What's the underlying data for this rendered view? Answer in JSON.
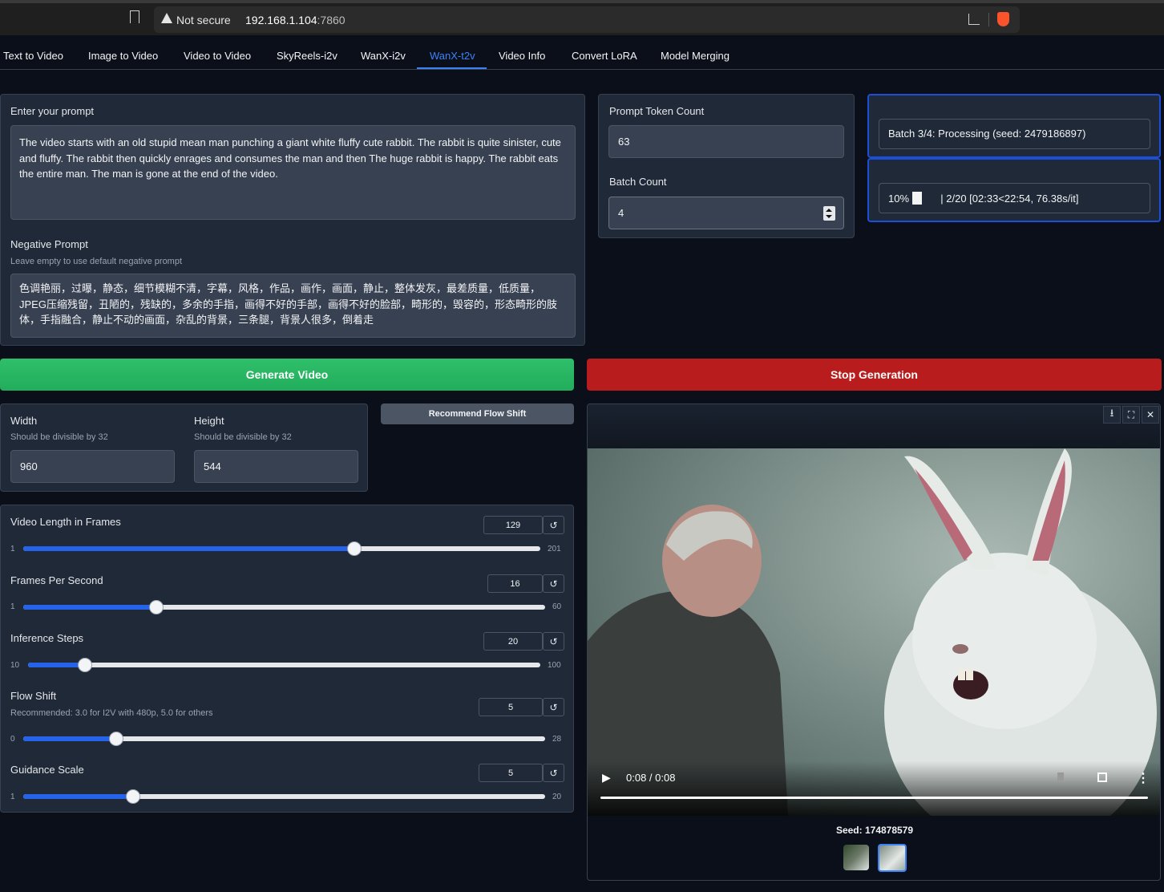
{
  "browser": {
    "security_label": "Not secure",
    "url_host": "192.168.1.104",
    "url_port": ":7860"
  },
  "tabs": [
    {
      "label": "Text to Video"
    },
    {
      "label": "Image to Video"
    },
    {
      "label": "Video to Video"
    },
    {
      "label": "SkyReels-i2v"
    },
    {
      "label": "WanX-i2v"
    },
    {
      "label": "WanX-t2v"
    },
    {
      "label": "Video Info"
    },
    {
      "label": "Convert LoRA"
    },
    {
      "label": "Model Merging"
    }
  ],
  "active_tab": "WanX-t2v",
  "prompt": {
    "label": "Enter your prompt",
    "value": "The video starts with an old stupid mean man punching a giant white fluffy cute rabbit. The rabbit is quite sinister, cute and fluffy. The rabbit then quickly enrages and consumes the man and then The huge rabbit is happy. The rabbit eats the entire man. The man is gone at the end of the video."
  },
  "negative_prompt": {
    "label": "Negative Prompt",
    "hint": "Leave empty to use default negative prompt",
    "value": "色调艳丽，过曝，静态，细节模糊不清，字幕，风格，作品，画作，画面，静止，整体发灰，最差质量，低质量，JPEG压缩残留，丑陋的，残缺的，多余的手指，画得不好的手部，画得不好的脸部，畸形的，毁容的，形态畸形的肢体，手指融合，静止不动的画面，杂乱的背景，三条腿，背景人很多，倒着走"
  },
  "token_count": {
    "label": "Prompt Token Count",
    "value": "63"
  },
  "batch_count": {
    "label": "Batch Count",
    "value": "4"
  },
  "status": {
    "batch_text": "Batch 3/4: Processing (seed: 2479186897)",
    "progress_percent": "10%",
    "progress_fraction": 0.1,
    "progress_detail": "| 2/20 [02:33<22:54, 76.38s/it]"
  },
  "buttons": {
    "generate": "Generate Video",
    "stop": "Stop Generation",
    "recommend_flow_shift": "Recommend Flow Shift"
  },
  "colors": {
    "green": "#22c55e",
    "red": "#b91c1c",
    "accent": "#3b82f6"
  },
  "width_field": {
    "label": "Width",
    "hint": "Should be divisible by 32",
    "value": "960"
  },
  "height_field": {
    "label": "Height",
    "hint": "Should be divisible by 32",
    "value": "544"
  },
  "sliders": {
    "video_length": {
      "label": "Video Length in Frames",
      "value": "129",
      "min": "1",
      "max": "201",
      "num": 129,
      "lo": 1,
      "hi": 201
    },
    "fps": {
      "label": "Frames Per Second",
      "value": "16",
      "min": "1",
      "max": "60",
      "num": 16,
      "lo": 1,
      "hi": 60
    },
    "steps": {
      "label": "Inference Steps",
      "value": "20",
      "min": "10",
      "max": "100",
      "num": 20,
      "lo": 10,
      "hi": 100
    },
    "flow_shift": {
      "label": "Flow Shift",
      "hint": "Recommended: 3.0 for I2V with 480p, 5.0 for others",
      "value": "5",
      "min": "0",
      "max": "28",
      "num": 5,
      "lo": 0,
      "hi": 28
    },
    "guidance": {
      "label": "Guidance Scale",
      "value": "5",
      "min": "1",
      "max": "20",
      "num": 5,
      "lo": 1,
      "hi": 20
    }
  },
  "video": {
    "time": "0:08 / 0:08",
    "seed_text": "Seed: 174878579"
  },
  "icons": {
    "reset": "↺",
    "play": "▶",
    "more": "⋮",
    "close": "✕",
    "download": "⭳",
    "fullscreen": "⛶"
  }
}
